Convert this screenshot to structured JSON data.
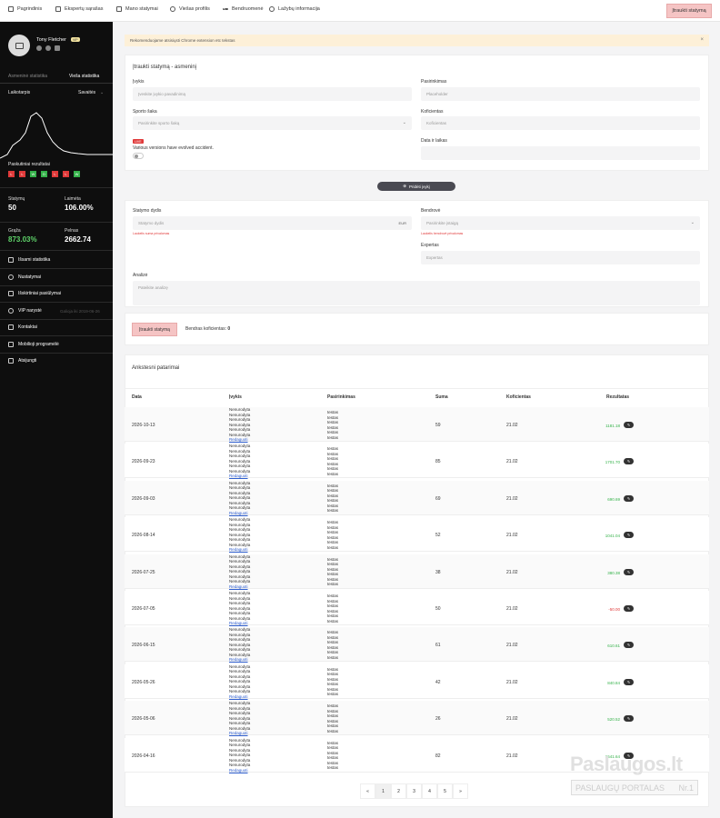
{
  "topnav": {
    "items": [
      {
        "label": "Pagrindinis",
        "icon": "home-icon"
      },
      {
        "label": "Ekspertų sąrašas",
        "icon": "list-icon"
      },
      {
        "label": "Mano statymai",
        "icon": "document-icon"
      },
      {
        "label": "Viešas profilis",
        "icon": "user-icon"
      },
      {
        "label": "Bendruomenė",
        "icon": "dots-icon"
      },
      {
        "label": "Lažybų informacija",
        "icon": "info-icon"
      }
    ],
    "cta": "Įtraukti statymą"
  },
  "sidebar": {
    "user": {
      "name": "Tony Fletcher",
      "badge": "VIP"
    },
    "tabs": {
      "personal": "Asmeninė statistika",
      "public": "Vieša statistika"
    },
    "period": {
      "label": "Laikotarpis",
      "value": "Savaitės"
    },
    "recent_results_label": "Paskutiniai rezultatai",
    "recent_results": [
      "L",
      "L",
      "W",
      "D",
      "L",
      "L",
      "W"
    ],
    "stats": [
      {
        "label": "Statymų",
        "value": "50"
      },
      {
        "label": "Laimėta",
        "value": "106.00%"
      },
      {
        "label": "Grąža",
        "value": "873.03%"
      },
      {
        "label": "Pelnas",
        "value": "2662.74"
      }
    ],
    "menu": [
      {
        "label": "Išsami statistika",
        "icon": "chart-icon"
      },
      {
        "label": "Nustatymai",
        "icon": "gear-icon"
      },
      {
        "label": "Išskirtiniai pasiūlymai",
        "icon": "tag-icon"
      },
      {
        "label": "VIP narystė",
        "icon": "star-icon",
        "extra": "Galioja iki 2019-06-26"
      },
      {
        "label": "Kontaktai",
        "icon": "mail-icon"
      },
      {
        "label": "Mobilioji programėlė",
        "icon": "phone-icon"
      },
      {
        "label": "Atsijungti",
        "icon": "logout-icon"
      }
    ]
  },
  "banner": {
    "text": "Rekomenduojame atsisiųsti Chrome extension etc tekstas"
  },
  "form": {
    "title": "Įtraukti statymą - asmeninį",
    "event": {
      "label": "Įvykis",
      "placeholder": "Įveskite įvykio pavadinimą"
    },
    "selection": {
      "label": "Pasirinkimas",
      "placeholder": "Placeholder"
    },
    "sport": {
      "label": "Sporto šaka",
      "placeholder": "Pasirinkite sporto šaką"
    },
    "odds": {
      "label": "Koficientas",
      "placeholder": "Koficientas"
    },
    "live_badge": "LIVE",
    "live_text": "Various versions have evolved accident.",
    "datetime": {
      "label": "Data ir laikas"
    },
    "add_event_button": "Pridėti įvykį",
    "stake": {
      "label": "Statymo dydis",
      "placeholder": "Statymo dydis",
      "suffix": "EUR",
      "error": "Laukelis suma privalomas"
    },
    "bookmaker": {
      "label": "Bendrovė",
      "placeholder": "Pasirinkite įstaigą",
      "error": "Laukelis bendrovė privalomas"
    },
    "expert": {
      "label": "Expertas",
      "placeholder": "Expertas"
    },
    "analysis": {
      "label": "Analizė",
      "placeholder": "Pateikite analizę"
    },
    "submit": "Įtraukti statymą",
    "total_odds_label": "Bendras koficientas:",
    "total_odds_value": "0"
  },
  "history": {
    "title": "Ankstesni patarimai",
    "columns": [
      "Data",
      "Įvykis",
      "Pasirinkimas",
      "Suma",
      "Koficientas",
      "Rezultatas"
    ],
    "event_line": "Nenurodyta",
    "selection_line": "testas",
    "edit_label": "Redaguoti",
    "rows": [
      {
        "date": "2026-10-13",
        "amount": "59",
        "odds": "21.02",
        "result": "1181.18",
        "sign": "pos"
      },
      {
        "date": "2026-09-23",
        "amount": "85",
        "odds": "21.02",
        "result": "1701.70",
        "sign": "pos"
      },
      {
        "date": "2026-09-03",
        "amount": "69",
        "odds": "21.02",
        "result": "690.69",
        "sign": "pos"
      },
      {
        "date": "2026-08-14",
        "amount": "52",
        "odds": "21.02",
        "result": "1041.04",
        "sign": "pos"
      },
      {
        "date": "2026-07-25",
        "amount": "38",
        "odds": "21.02",
        "result": "380.38",
        "sign": "pos"
      },
      {
        "date": "2026-07-05",
        "amount": "50",
        "odds": "21.02",
        "result": "-50.00",
        "sign": "neg"
      },
      {
        "date": "2026-06-15",
        "amount": "61",
        "odds": "21.02",
        "result": "610.61",
        "sign": "pos"
      },
      {
        "date": "2026-05-26",
        "amount": "42",
        "odds": "21.02",
        "result": "840.84",
        "sign": "pos"
      },
      {
        "date": "2026-05-06",
        "amount": "26",
        "odds": "21.02",
        "result": "520.52",
        "sign": "pos"
      },
      {
        "date": "2026-04-16",
        "amount": "82",
        "odds": "21.02",
        "result": "1641.64",
        "sign": "pos"
      }
    ],
    "pages": [
      "«",
      "1",
      "2",
      "3",
      "4",
      "5",
      "»"
    ],
    "active_page": "1"
  },
  "watermark": {
    "line1": "Paslaugos.lt",
    "line2": "PASLAUGŲ PORTALAS",
    "badge": "Nr.1"
  },
  "colors": {
    "accent": "#f5c4c4",
    "positive": "#35b24a",
    "negative": "#e03a3a",
    "sidebar": "#0e0e0e"
  }
}
